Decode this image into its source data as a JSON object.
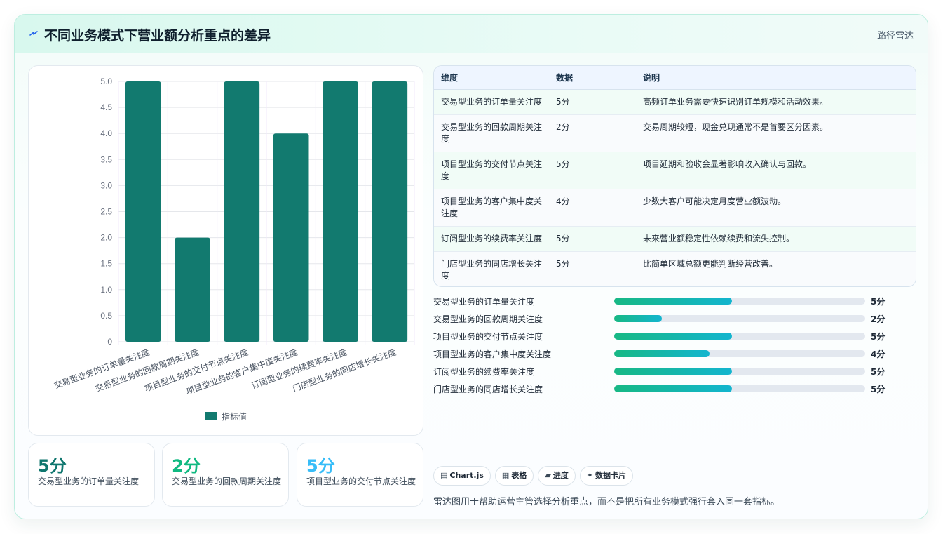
{
  "header": {
    "title": "不同业务模式下营业额分析重点的差异",
    "tag": "路径雷达"
  },
  "colors": {
    "accent": "#127a6f",
    "stat_value_colors": [
      "#0f766e",
      "#10b981",
      "#38bdf8"
    ]
  },
  "chart_data": {
    "type": "bar",
    "categories": [
      "交易型业务的订单量关注度",
      "交易型业务的回款周期关注度",
      "项目型业务的交付节点关注度",
      "项目型业务的客户集中度关注度",
      "订阅型业务的续费率关注度",
      "门店型业务的同店增长关注度"
    ],
    "series": [
      {
        "name": "指标值",
        "values": [
          5,
          2,
          5,
          4,
          5,
          5
        ]
      }
    ],
    "ylim": [
      0,
      5
    ],
    "yticks": [
      "0",
      "0.5",
      "1.0",
      "1.5",
      "2.0",
      "2.5",
      "3.0",
      "3.5",
      "4.0",
      "4.5",
      "5.0"
    ],
    "legend": "bottom",
    "color": "#127a6f"
  },
  "stats": [
    {
      "value": "5分",
      "label": "交易型业务的订单量关注度"
    },
    {
      "value": "2分",
      "label": "交易型业务的回款周期关注度"
    },
    {
      "value": "5分",
      "label": "项目型业务的交付节点关注度"
    }
  ],
  "table": {
    "headers": [
      "维度",
      "数据",
      "说明"
    ],
    "rows": [
      [
        "交易型业务的订单量关注度",
        "5分",
        "高频订单业务需要快速识别订单规模和活动效果。"
      ],
      [
        "交易型业务的回款周期关注度",
        "2分",
        "交易周期较短，现金兑现通常不是首要区分因素。"
      ],
      [
        "项目型业务的交付节点关注度",
        "5分",
        "项目延期和验收会显著影响收入确认与回款。"
      ],
      [
        "项目型业务的客户集中度关注度",
        "4分",
        "少数大客户可能决定月度营业额波动。"
      ],
      [
        "订阅型业务的续费率关注度",
        "5分",
        "未来营业额稳定性依赖续费和流失控制。"
      ],
      [
        "门店型业务的同店增长关注度",
        "5分",
        "比简单区域总额更能判断经营改善。"
      ]
    ]
  },
  "progress": [
    {
      "label": "交易型业务的订单量关注度",
      "value": "5分",
      "fraction": 0.47
    },
    {
      "label": "交易型业务的回款周期关注度",
      "value": "2分",
      "fraction": 0.19
    },
    {
      "label": "项目型业务的交付节点关注度",
      "value": "5分",
      "fraction": 0.47
    },
    {
      "label": "项目型业务的客户集中度关注度",
      "value": "4分",
      "fraction": 0.38
    },
    {
      "label": "订阅型业务的续费率关注度",
      "value": "5分",
      "fraction": 0.47
    },
    {
      "label": "门店型业务的同店增长关注度",
      "value": "5分",
      "fraction": 0.47
    }
  ],
  "chips": [
    {
      "icon": "chart-icon",
      "glyph": "▤",
      "label": "Chart.js"
    },
    {
      "icon": "table-icon",
      "glyph": "▦",
      "label": "表格"
    },
    {
      "icon": "progress-icon",
      "glyph": "▰",
      "label": "进度"
    },
    {
      "icon": "card-icon",
      "glyph": "✦",
      "label": "数据卡片"
    }
  ],
  "note": "雷达图用于帮助运营主管选择分析重点，而不是把所有业务模式强行套入同一套指标。"
}
